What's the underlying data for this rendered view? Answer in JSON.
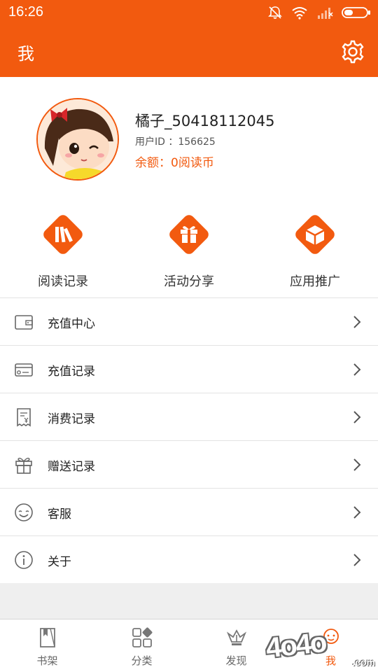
{
  "status_bar": {
    "time": "16:26"
  },
  "header": {
    "title": "我"
  },
  "profile": {
    "username": "橘子_50418112045",
    "user_id": "用户ID ：156625",
    "balance": "余额：0阅读币"
  },
  "quick_actions": [
    {
      "label": "阅读记录",
      "icon": "reading-record-icon"
    },
    {
      "label": "活动分享",
      "icon": "gift-share-icon"
    },
    {
      "label": "应用推广",
      "icon": "box-promote-icon"
    }
  ],
  "menu": [
    {
      "label": "充值中心",
      "icon": "wallet-icon"
    },
    {
      "label": "充值记录",
      "icon": "card-icon"
    },
    {
      "label": "消费记录",
      "icon": "receipt-icon"
    },
    {
      "label": "赠送记录",
      "icon": "gift-icon"
    },
    {
      "label": "客服",
      "icon": "smiley-icon"
    },
    {
      "label": "关于",
      "icon": "info-icon"
    }
  ],
  "tabs": [
    {
      "label": "书架",
      "icon": "bookshelf-icon"
    },
    {
      "label": "分类",
      "icon": "category-icon"
    },
    {
      "label": "发现",
      "icon": "discover-icon"
    },
    {
      "label": "我",
      "icon": "me-icon",
      "active": true
    }
  ],
  "watermark": {
    "text": "4o4o",
    "suffix": ".com"
  },
  "colors": {
    "accent": "#f25a0f",
    "background": "#efefef"
  }
}
